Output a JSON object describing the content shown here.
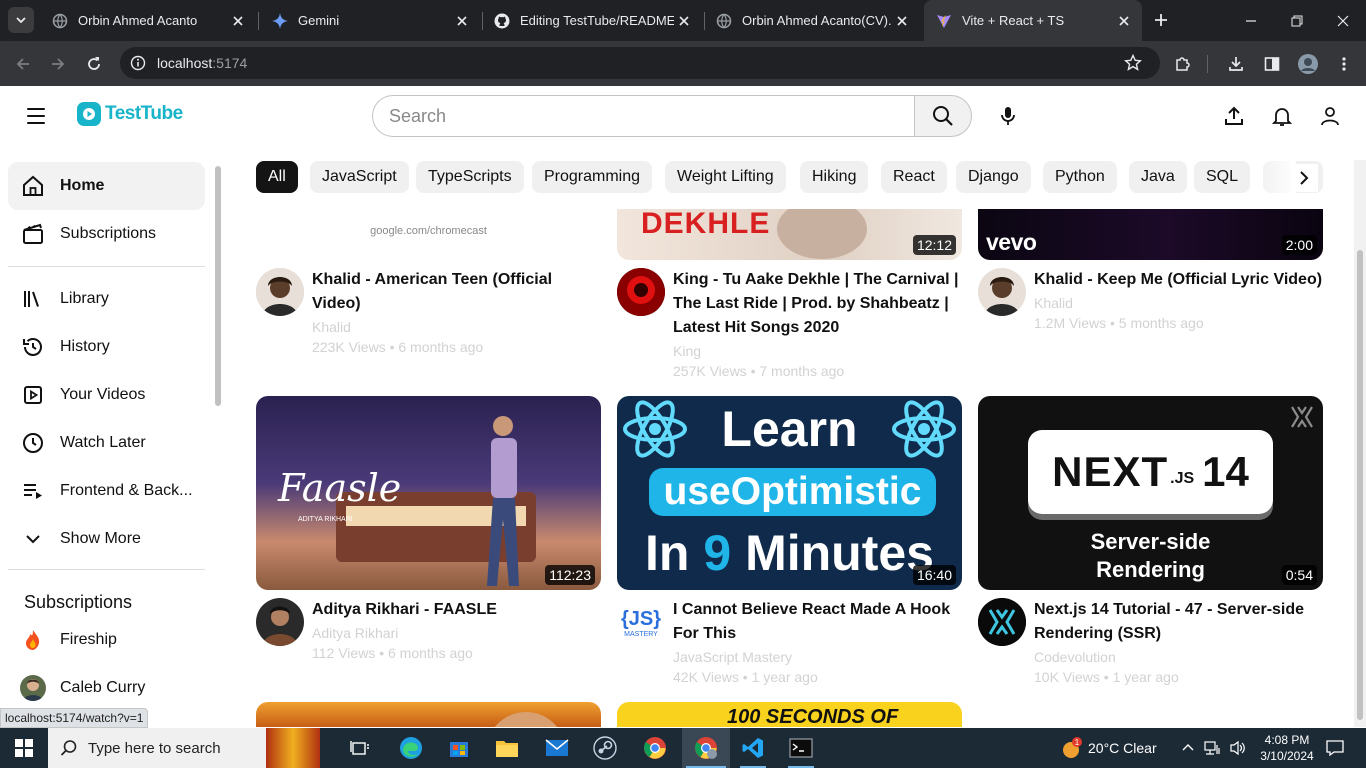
{
  "browser": {
    "tabs": [
      {
        "title": "Orbin Ahmed Acanto",
        "icon": "globe-icon",
        "active": false
      },
      {
        "title": "Gemini",
        "icon": "gemini-icon",
        "active": false
      },
      {
        "title": "Editing TestTube/README.m",
        "icon": "github-icon",
        "active": false
      },
      {
        "title": "Orbin Ahmed Acanto(CV).pc",
        "icon": "globe-icon",
        "active": false
      },
      {
        "title": "Vite + React + TS",
        "icon": "vite-icon",
        "active": true
      }
    ],
    "url_host": "localhost",
    "url_port": ":5174"
  },
  "app": {
    "logo_text": "TestTube",
    "search_placeholder": "Search"
  },
  "sidebar": {
    "items": [
      {
        "label": "Home",
        "icon": "home-icon",
        "active": true
      },
      {
        "label": "Subscriptions",
        "icon": "clapperboard-icon",
        "active": false
      },
      {
        "label": "Library",
        "icon": "library-icon",
        "active": false
      },
      {
        "label": "History",
        "icon": "history-icon",
        "active": false
      },
      {
        "label": "Your Videos",
        "icon": "play-square-icon",
        "active": false
      },
      {
        "label": "Watch Later",
        "icon": "clock-icon",
        "active": false
      },
      {
        "label": "Frontend & Back...",
        "icon": "playlist-icon",
        "active": false
      },
      {
        "label": "Show More",
        "icon": "chevron-down-icon",
        "active": false
      }
    ],
    "subscriptions_heading": "Subscriptions",
    "subscriptions": [
      {
        "name": "Fireship"
      },
      {
        "name": "Caleb Curry"
      }
    ]
  },
  "categories": [
    "All",
    "JavaScript",
    "TypeScripts",
    "Programming",
    "Weight Lifting",
    "Hiking",
    "React",
    "Django",
    "Python",
    "Java",
    "SQL"
  ],
  "videos": [
    {
      "title": "Khalid - American Teen (Official Video)",
      "channel": "Khalid",
      "views": "223K Views",
      "age": "6 months ago",
      "thumb_text": "google.com/chromecast",
      "duration": ""
    },
    {
      "title": "King - Tu Aake Dekhle | The Carnival | The Last Ride | Prod. by Shahbeatz | Latest Hit Songs 2020",
      "channel": "King",
      "views": "257K Views",
      "age": "7 months ago",
      "thumb_text": "DEKHLE",
      "duration": "12:12"
    },
    {
      "title": "Khalid - Keep Me (Official Lyric Video)",
      "channel": "Khalid",
      "views": "1.2M Views",
      "age": "5 months ago",
      "thumb_text": "vevo",
      "duration": "2:00"
    },
    {
      "title": "Aditya Rikhari - FAASLE",
      "channel": "Aditya Rikhari",
      "views": "112 Views",
      "age": "6 months ago",
      "thumb_text": "Faasle",
      "thumb_subtext": "ADITYA RIKHARI",
      "duration": "112:23"
    },
    {
      "title": "I Cannot Believe React Made A Hook For This",
      "channel": "JavaScript Mastery",
      "views": "42K Views",
      "age": "1 year ago",
      "thumb_line1": "Learn",
      "thumb_line2": "useOptimistic",
      "thumb_line3_a": "In",
      "thumb_line3_b": "9",
      "thumb_line3_c": "Minutes",
      "duration": "16:40"
    },
    {
      "title": "Next.js 14 Tutorial - 47 - Server-side Rendering (SSR)",
      "channel": "Codevolution",
      "views": "10K Views",
      "age": "1 year ago",
      "thumb_logo": "NEXT",
      "thumb_js": ".JS",
      "thumb_ver": "14",
      "thumb_caption": "Server-side Rendering",
      "duration": "0:54"
    }
  ],
  "partial_thumb_text": "100 SECONDS OF",
  "status_url": "localhost:5174/watch?v=1",
  "taskbar": {
    "search_placeholder": "Type here to search",
    "weather": "20°C  Clear",
    "weather_badge": "1",
    "time": "4:08 PM",
    "date": "3/10/2024"
  },
  "colors": {
    "brand": "#18b4c9",
    "chrome_dark": "#202124",
    "chrome_toolbar": "#35363a",
    "react_blue": "#61dafb"
  }
}
